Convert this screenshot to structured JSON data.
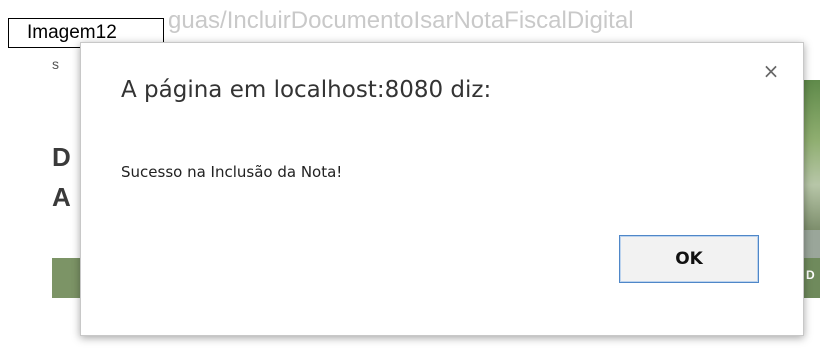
{
  "caption": {
    "label": "Imagem12"
  },
  "background_page": {
    "url_text": "guas/IncluirDocumentoIsarNotaFiscalDigital",
    "left_small": "s",
    "left_letter_1": "D",
    "left_letter_2": "A",
    "right_letter": "D",
    "colors": {
      "green": "#7c9466",
      "grey": "#9aa69a"
    }
  },
  "dialog": {
    "title": "A página em localhost:8080 diz:",
    "message": "Sucesso na Inclusão da Nota!",
    "ok_label": "OK",
    "close_glyph": "×",
    "colors": {
      "ok_border": "#4f87c8",
      "title_text": "#333333"
    }
  }
}
